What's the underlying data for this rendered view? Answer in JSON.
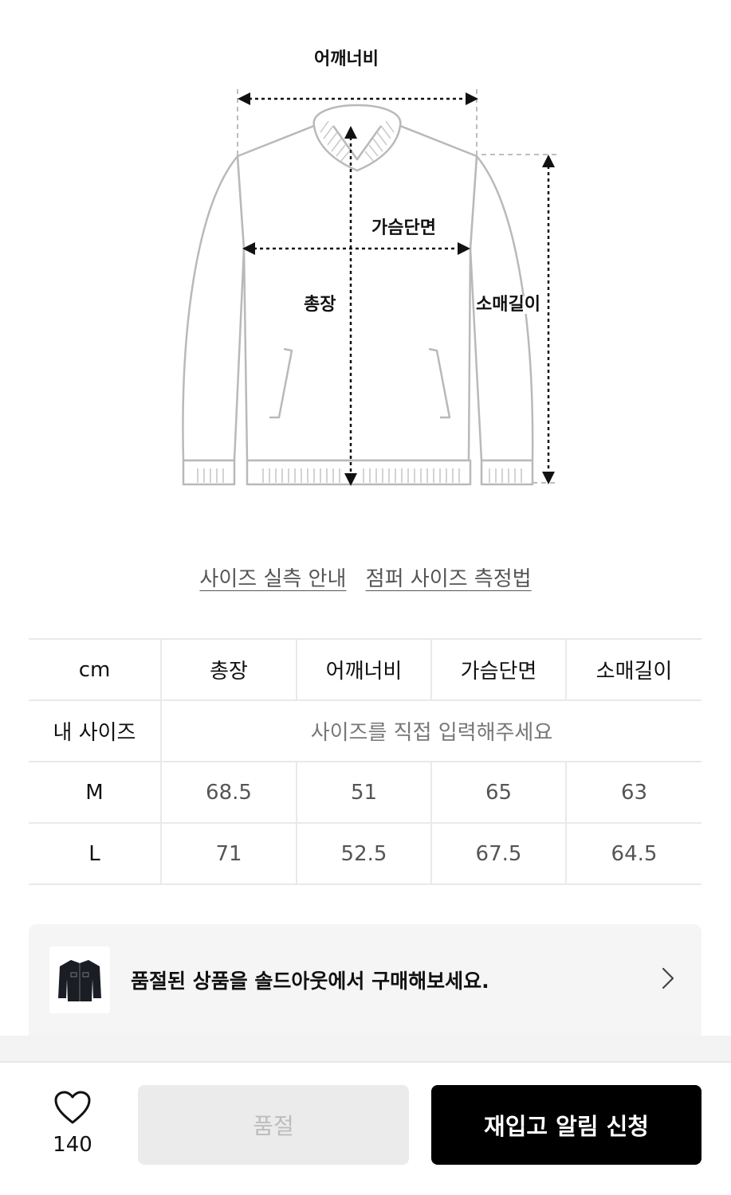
{
  "diagram": {
    "labels": {
      "shoulder": "어깨너비",
      "chest": "가슴단면",
      "length": "총장",
      "sleeve": "소매길이"
    }
  },
  "links": {
    "size_guide": "사이즈 실측 안내",
    "measure_method": "점퍼 사이즈 측정법"
  },
  "size_table": {
    "unit": "cm",
    "headers": [
      "총장",
      "어깨너비",
      "가슴단면",
      "소매길이"
    ],
    "my_size_label": "내 사이즈",
    "my_size_placeholder": "사이즈를 직접 입력해주세요",
    "rows": [
      {
        "size": "M",
        "values": [
          "68.5",
          "51",
          "65",
          "63"
        ]
      },
      {
        "size": "L",
        "values": [
          "71",
          "52.5",
          "67.5",
          "64.5"
        ]
      }
    ]
  },
  "promo": {
    "text": "품절된 상품을 솔드아웃에서 구매해보세요.",
    "thumb_icon": "jacket-thumbnail",
    "arrow_icon": "chevron-right-icon"
  },
  "bottom_bar": {
    "like_icon": "heart-icon",
    "like_count": "140",
    "soldout_label": "품절",
    "restock_label": "재입고 알림 신청"
  }
}
